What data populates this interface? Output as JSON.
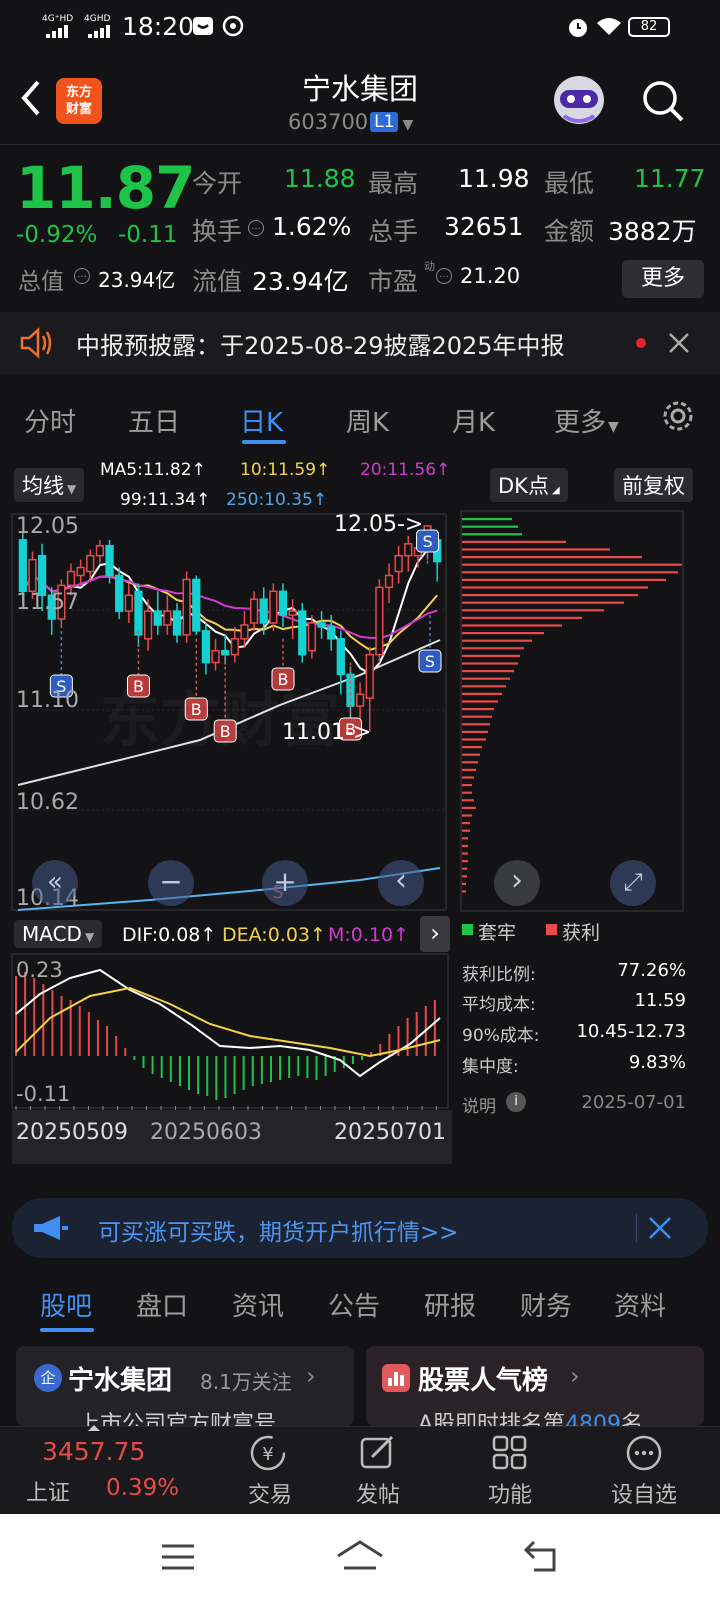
{
  "status_bar": {
    "time": "18:20",
    "net1": "4G⁺HD",
    "net2": "4GHD",
    "battery": "82"
  },
  "header": {
    "title": "宁水集团",
    "code": "603700",
    "level": "L1",
    "logo_line1": "东方",
    "logo_line2": "财富"
  },
  "quote": {
    "price": "11.87",
    "change_pct": "-0.92%",
    "change": "-0.11",
    "open_label": "今开",
    "open": "11.88",
    "high_label": "最高",
    "high": "11.98",
    "low_label": "最低",
    "low": "11.77",
    "turnover_label": "换手",
    "turnover": "1.62%",
    "volume_label": "总手",
    "volume": "32651",
    "amount_label": "金额",
    "amount": "3882万",
    "mktcap_label": "总值",
    "mktcap": "23.94亿",
    "float_label": "流值",
    "float_cap": "23.94亿",
    "pe_label": "市盈",
    "pe_sup": "动",
    "pe": "21.20",
    "more_button": "更多"
  },
  "notice": {
    "text": "中报预披露：于2025-08-29披露2025年中报"
  },
  "period_tabs": [
    {
      "label": "分时",
      "active": false
    },
    {
      "label": "五日",
      "active": false
    },
    {
      "label": "日K",
      "active": true
    },
    {
      "label": "周K",
      "active": false
    },
    {
      "label": "月K",
      "active": false
    },
    {
      "label": "更多",
      "active": false
    }
  ],
  "chart_toolbar": {
    "indicator": "均线",
    "ma5": "MA5:11.82↑",
    "ma10": "10:11.59↑",
    "ma20": "20:11.56↑",
    "ma99": "99:11.34↑",
    "ma250": "250:10.35↑",
    "dk_button": "DK点",
    "fq_button": "前复权"
  },
  "kline": {
    "y_labels": [
      "12.05",
      "11.57",
      "11.10",
      "10.62",
      "10.14"
    ],
    "high_marker": "12.05->",
    "low_marker": "11.01->",
    "buy_marker": "B",
    "sell_marker": "S",
    "watermark": "东方财富"
  },
  "chart_data": {
    "type": "candlestick",
    "candles": [
      {
        "o": 11.98,
        "c": 11.72,
        "h": 12.02,
        "l": 11.66
      },
      {
        "o": 11.72,
        "c": 11.88,
        "h": 11.92,
        "l": 11.68
      },
      {
        "o": 11.9,
        "c": 11.7,
        "h": 11.96,
        "l": 11.62
      },
      {
        "o": 11.7,
        "c": 11.58,
        "h": 11.74,
        "l": 11.5
      },
      {
        "o": 11.58,
        "c": 11.75,
        "h": 11.78,
        "l": 11.54
      },
      {
        "o": 11.75,
        "c": 11.82,
        "h": 11.86,
        "l": 11.7
      },
      {
        "o": 11.8,
        "c": 11.84,
        "h": 11.88,
        "l": 11.76
      },
      {
        "o": 11.82,
        "c": 11.9,
        "h": 11.93,
        "l": 11.78
      },
      {
        "o": 11.9,
        "c": 11.95,
        "h": 11.98,
        "l": 11.86
      },
      {
        "o": 11.95,
        "c": 11.8,
        "h": 11.98,
        "l": 11.76
      },
      {
        "o": 11.8,
        "c": 11.62,
        "h": 11.84,
        "l": 11.58
      },
      {
        "o": 11.62,
        "c": 11.7,
        "h": 11.76,
        "l": 11.56
      },
      {
        "o": 11.72,
        "c": 11.5,
        "h": 11.76,
        "l": 11.44
      },
      {
        "o": 11.48,
        "c": 11.62,
        "h": 11.68,
        "l": 11.42
      },
      {
        "o": 11.62,
        "c": 11.55,
        "h": 11.72,
        "l": 11.5
      },
      {
        "o": 11.55,
        "c": 11.62,
        "h": 11.7,
        "l": 11.5
      },
      {
        "o": 11.62,
        "c": 11.5,
        "h": 11.66,
        "l": 11.46
      },
      {
        "o": 11.5,
        "c": 11.78,
        "h": 11.82,
        "l": 11.46
      },
      {
        "o": 11.78,
        "c": 11.52,
        "h": 11.8,
        "l": 11.5
      },
      {
        "o": 11.52,
        "c": 11.36,
        "h": 11.56,
        "l": 11.3
      },
      {
        "o": 11.36,
        "c": 11.42,
        "h": 11.48,
        "l": 11.32
      },
      {
        "o": 11.42,
        "c": 11.4,
        "h": 11.5,
        "l": 11.35
      },
      {
        "o": 11.4,
        "c": 11.48,
        "h": 11.54,
        "l": 11.36
      },
      {
        "o": 11.48,
        "c": 11.55,
        "h": 11.62,
        "l": 11.44
      },
      {
        "o": 11.56,
        "c": 11.68,
        "h": 11.72,
        "l": 11.52
      },
      {
        "o": 11.68,
        "c": 11.56,
        "h": 11.74,
        "l": 11.5
      },
      {
        "o": 11.56,
        "c": 11.72,
        "h": 11.76,
        "l": 11.52
      },
      {
        "o": 11.72,
        "c": 11.6,
        "h": 11.76,
        "l": 11.54
      },
      {
        "o": 11.6,
        "c": 11.62,
        "h": 11.68,
        "l": 11.48
      },
      {
        "o": 11.62,
        "c": 11.4,
        "h": 11.66,
        "l": 11.36
      },
      {
        "o": 11.42,
        "c": 11.56,
        "h": 11.6,
        "l": 11.38
      },
      {
        "o": 11.56,
        "c": 11.54,
        "h": 11.62,
        "l": 11.48
      },
      {
        "o": 11.54,
        "c": 11.48,
        "h": 11.6,
        "l": 11.42
      },
      {
        "o": 11.48,
        "c": 11.3,
        "h": 11.52,
        "l": 11.2
      },
      {
        "o": 11.3,
        "c": 11.14,
        "h": 11.34,
        "l": 11.08
      },
      {
        "o": 11.14,
        "c": 11.2,
        "h": 11.26,
        "l": 11.06
      },
      {
        "o": 11.18,
        "c": 11.4,
        "h": 11.44,
        "l": 11.01
      },
      {
        "o": 11.4,
        "c": 11.74,
        "h": 11.78,
        "l": 11.36
      },
      {
        "o": 11.74,
        "c": 11.8,
        "h": 11.86,
        "l": 11.66
      },
      {
        "o": 11.82,
        "c": 11.9,
        "h": 11.95,
        "l": 11.76
      },
      {
        "o": 11.9,
        "c": 11.96,
        "h": 12.0,
        "l": 11.82
      },
      {
        "o": 11.9,
        "c": 11.94,
        "h": 11.98,
        "l": 11.84
      },
      {
        "o": 11.94,
        "c": 12.05,
        "h": 12.05,
        "l": 11.88
      },
      {
        "o": 11.98,
        "c": 11.87,
        "h": 11.98,
        "l": 11.77
      }
    ],
    "x_labels": [
      "20250509",
      "20250603",
      "20250701"
    ],
    "y_range": [
      10.14,
      12.05
    ]
  },
  "chart_controls": [
    "«",
    "−",
    "+",
    "‹",
    "›",
    "⤢"
  ],
  "macd": {
    "label": "MACD",
    "dif": "DIF:0.08↑",
    "dea": "DEA:0.03↑",
    "m": "M:0.10↑",
    "y_top": "0.23",
    "y_bottom": "-0.11"
  },
  "chip": {
    "legend_locked": "套牢",
    "legend_profit": "获利",
    "rows": [
      {
        "label": "获利比例:",
        "value": "77.26%"
      },
      {
        "label": "平均成本:",
        "value": "11.59"
      },
      {
        "label": "90%成本:",
        "value": "10.45-12.73"
      },
      {
        "label": "集中度:",
        "value": "9.83%"
      }
    ],
    "note_label": "说明",
    "date": "2025-07-01"
  },
  "ad_banner": {
    "text": "可买涨可买跌，期货开户抓行情>>"
  },
  "bottom_tabs": [
    {
      "label": "股吧",
      "active": true
    },
    {
      "label": "盘口",
      "active": false
    },
    {
      "label": "资讯",
      "active": false
    },
    {
      "label": "公告",
      "active": false
    },
    {
      "label": "研报",
      "active": false
    },
    {
      "label": "财务",
      "active": false
    },
    {
      "label": "资料",
      "active": false
    }
  ],
  "cards": {
    "left_title": "宁水集团",
    "left_follow": "8.1万关注",
    "left_sub": "上市公司官方财富号",
    "left_badge": "企",
    "right_title": "股票人气榜",
    "right_sub_prefix": "A股即时排名第",
    "right_rank": "4809",
    "right_sub_suffix": "名"
  },
  "bottom_nav": {
    "index_value": "3457.75",
    "index_name": "上证",
    "index_change": "0.39%",
    "items": [
      "交易",
      "发帖",
      "功能",
      "设自选"
    ]
  }
}
